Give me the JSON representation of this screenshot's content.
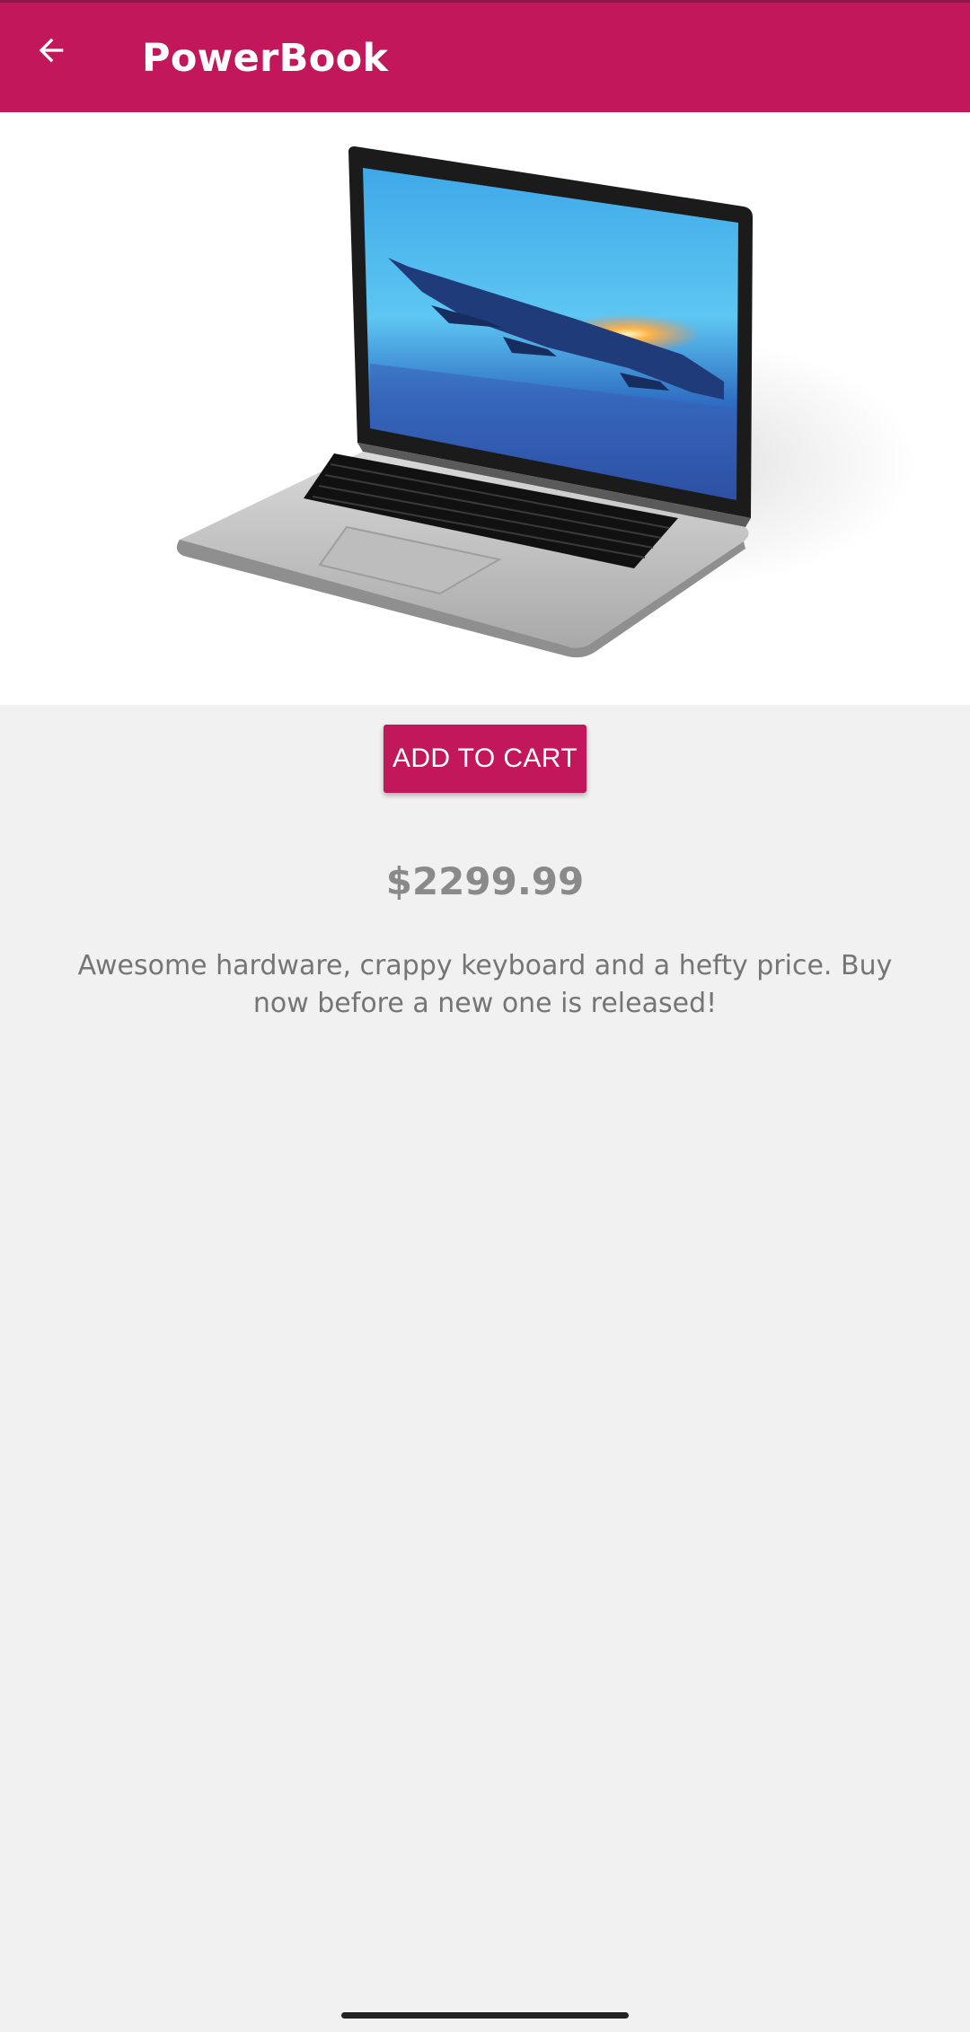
{
  "appbar": {
    "title": "PowerBook",
    "back_icon": "arrow-left-icon",
    "color": "#c2185b"
  },
  "product": {
    "image": "laptop-product-image",
    "add_to_cart_label": "ADD TO CART",
    "price": "$2299.99",
    "description": "Awesome hardware, crappy keyboard and a hefty price. Buy now before a new one is released!"
  },
  "colors": {
    "accent": "#c2185b",
    "background": "#f1f1f1"
  }
}
